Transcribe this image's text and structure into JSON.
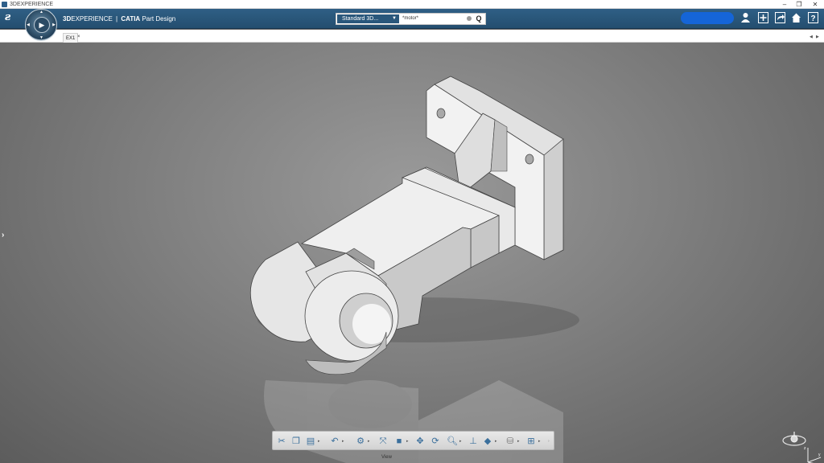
{
  "window": {
    "title": "3DEXPERIENCE",
    "minimize_glyph": "–",
    "restore_glyph": "❐",
    "close_glyph": "✕"
  },
  "header": {
    "brand_prefix": "3D",
    "brand_main": "EXPERIENCE",
    "separator": "|",
    "product": "CATIA",
    "app": "Part Design",
    "search": {
      "scope": "Standard 3D...",
      "query": "*motor*"
    },
    "accent_color": "#2a577b",
    "icons": [
      "user-icon",
      "plus-icon",
      "share-icon",
      "home-icon",
      "help-icon"
    ]
  },
  "tabs": [
    {
      "label": "EX1",
      "close": "×"
    }
  ],
  "viewport": {
    "background_colors": [
      "#9a9a9a",
      "#5c5c5c"
    ],
    "expand_glyph": "›"
  },
  "toolbar": {
    "section_label": "View",
    "section_dots": 8,
    "active_dot": 5,
    "tools": [
      "cut-icon",
      "copy-icon",
      "paste-icon",
      "undo-icon",
      "render-style-icon",
      "fit-all-icon",
      "view-cube-icon",
      "pan-icon",
      "rotate-icon",
      "zoom-icon",
      "normal-view-icon",
      "iso-view-icon",
      "cylinder-icon",
      "multi-view-icon"
    ]
  }
}
